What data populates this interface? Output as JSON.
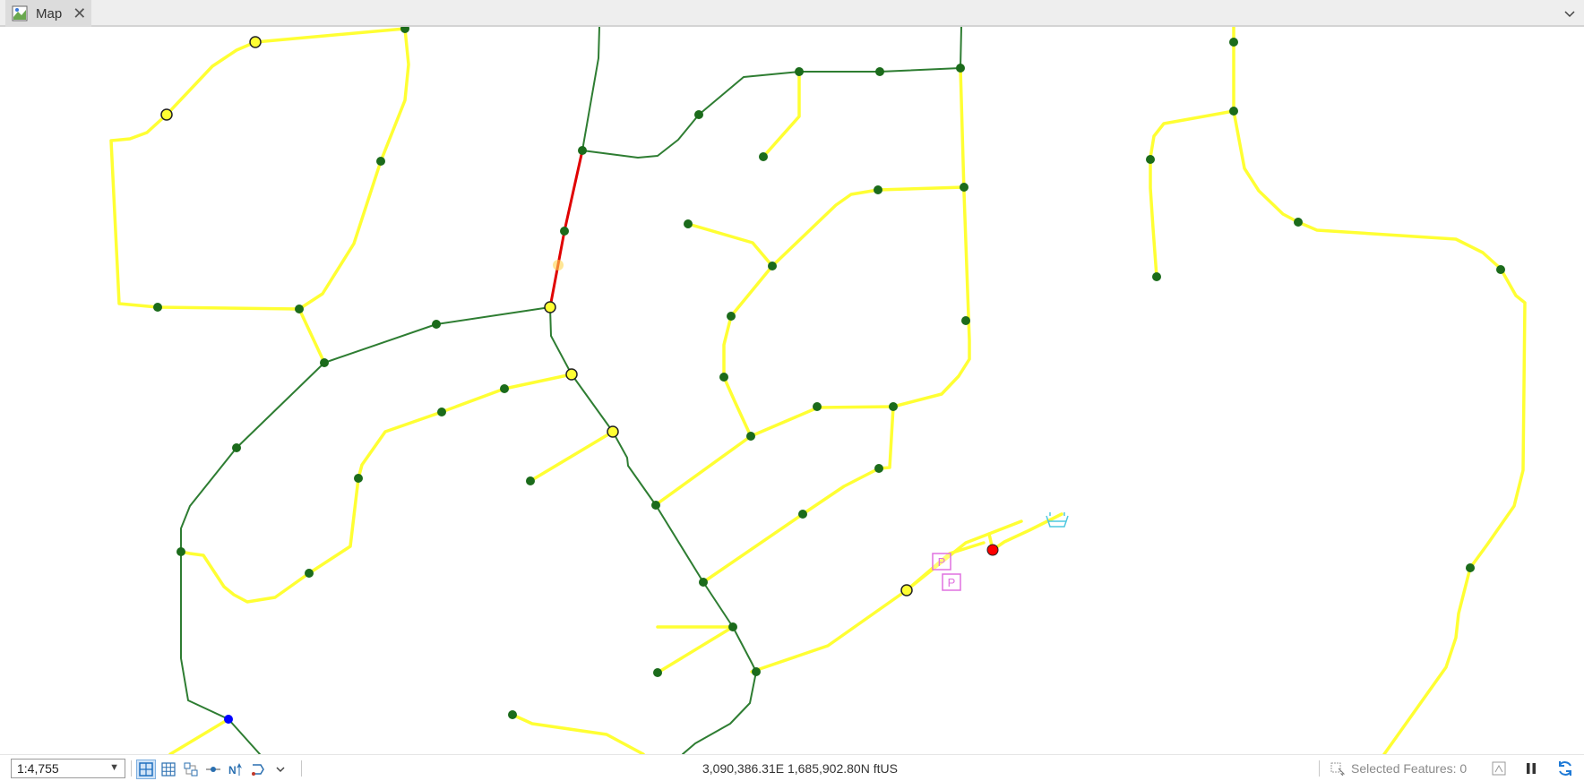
{
  "tab": {
    "label": "Map",
    "icon": "map-icon",
    "close_icon": "close-icon"
  },
  "statusbar": {
    "scale": "1:4,755",
    "coordinates": "3,090,386.31E 1,685,902.80N ftUS",
    "selected_features": "Selected Features: 0",
    "tools": [
      "snapping-toggle-icon",
      "grid-toggle-icon",
      "constraints-icon",
      "snap-point-icon",
      "north-arrow-icon",
      "correction-icon",
      "more-chevron-icon"
    ],
    "right_icons": [
      "selection-filter-icon",
      "pause-drawing-icon",
      "refresh-icon"
    ]
  },
  "colors": {
    "yellow_line": "#ffff33",
    "green_line": "#2e7d32",
    "red_line": "#e00000",
    "green_vertex": "#1b6b1b",
    "yellow_vertex": "#ffff33",
    "red_point": "#ff0000",
    "blue_point": "#0000ff",
    "parking_symbol": "#e070e0",
    "cyan_symbol": "#4fc8e0"
  },
  "map_labels": {
    "parking": "P"
  }
}
